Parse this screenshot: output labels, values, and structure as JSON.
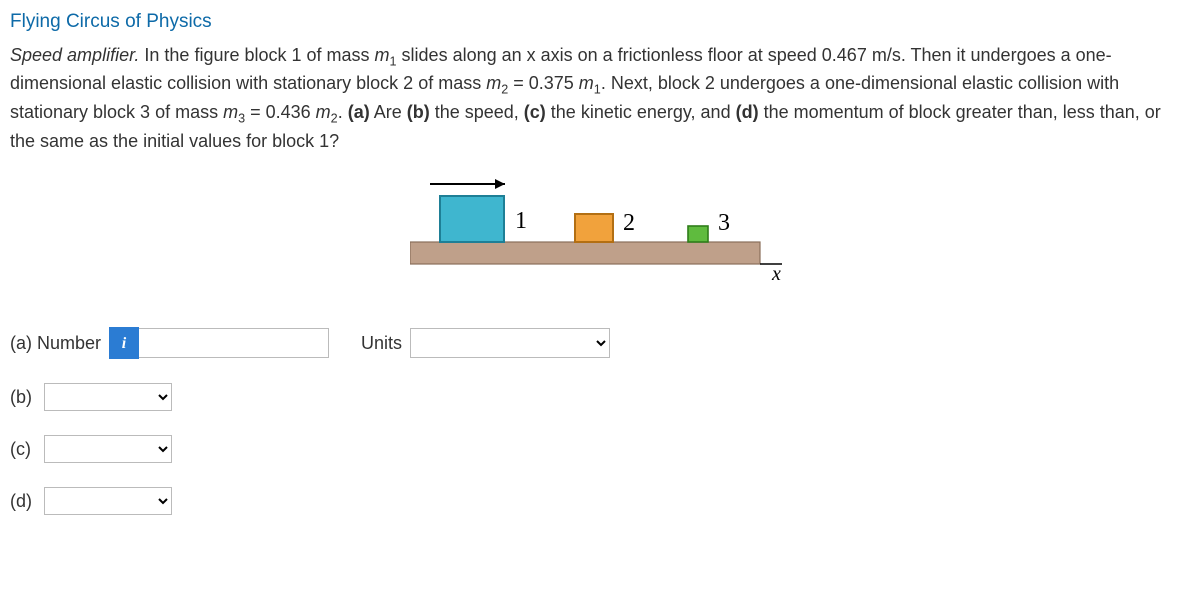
{
  "title": "Flying Circus of Physics",
  "problem": {
    "lead_italic": "Speed amplifier.",
    "text_1": " In the figure block 1 of mass ",
    "m1": "m",
    "m1_sub": "1",
    "text_2": " slides along an x axis on a frictionless floor at speed 0.467 m/s. Then it undergoes a one-dimensional elastic collision with stationary block 2 of mass ",
    "m2": "m",
    "m2_sub": "2",
    "eq2": " = 0.375 ",
    "m2r": "m",
    "m2r_sub": "1",
    "text_3": ". Next, block 2 undergoes a one-dimensional elastic collision with stationary block 3 of mass ",
    "m3": "m",
    "m3_sub": "3",
    "eq3": " = 0.436 ",
    "m3r": "m",
    "m3r_sub": "2",
    "text_4": ". ",
    "qa_b": "(a)",
    "qa_t": " Are ",
    "qb_b": "(b)",
    "qb_t": " the speed, ",
    "qc_b": "(c)",
    "qc_t": " the kinetic energy, and ",
    "qd_b": "(d)",
    "qd_t": " the momentum of block greater than, less than, or the same as the initial values for block 1?"
  },
  "figure": {
    "l1": "1",
    "l2": "2",
    "l3": "3",
    "axis": "x"
  },
  "answers": {
    "a_label": "(a) Number",
    "info_icon": "i",
    "units_label": "Units",
    "b_label": "(b)",
    "c_label": "(c)",
    "d_label": "(d)"
  }
}
